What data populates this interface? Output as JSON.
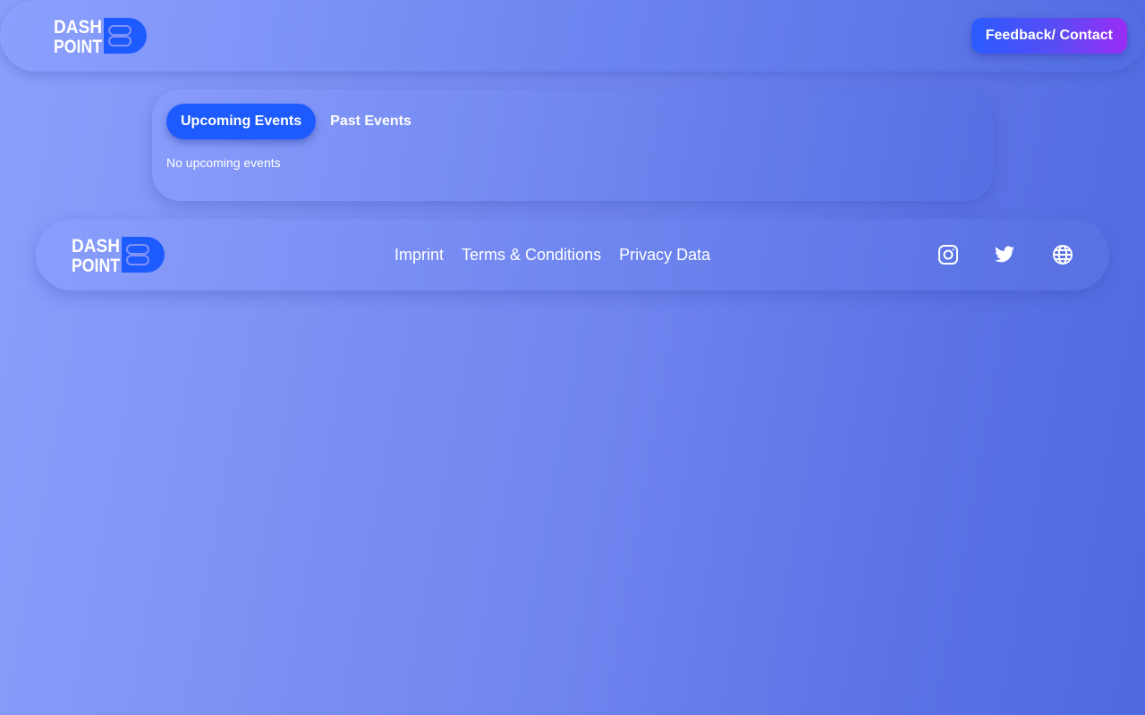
{
  "header": {
    "logo": {
      "line1": "DASH",
      "line2": "POINT"
    },
    "feedback_label": "Feedback/ Contact"
  },
  "events": {
    "tabs": [
      {
        "label": "Upcoming Events",
        "active": true
      },
      {
        "label": "Past Events",
        "active": false
      }
    ],
    "empty_message": "No upcoming events"
  },
  "footer": {
    "logo": {
      "line1": "DASH",
      "line2": "POINT"
    },
    "links": [
      {
        "label": "Imprint"
      },
      {
        "label": "Terms & Conditions"
      },
      {
        "label": "Privacy Data"
      }
    ],
    "social": [
      {
        "icon": "instagram-icon"
      },
      {
        "icon": "twitter-icon"
      },
      {
        "icon": "globe-icon"
      }
    ]
  },
  "colors": {
    "brand_blue": "#1e5bff",
    "feedback_gradient_start": "#2a5cff",
    "feedback_gradient_end": "#9b2cf6",
    "text": "#ffffff"
  }
}
